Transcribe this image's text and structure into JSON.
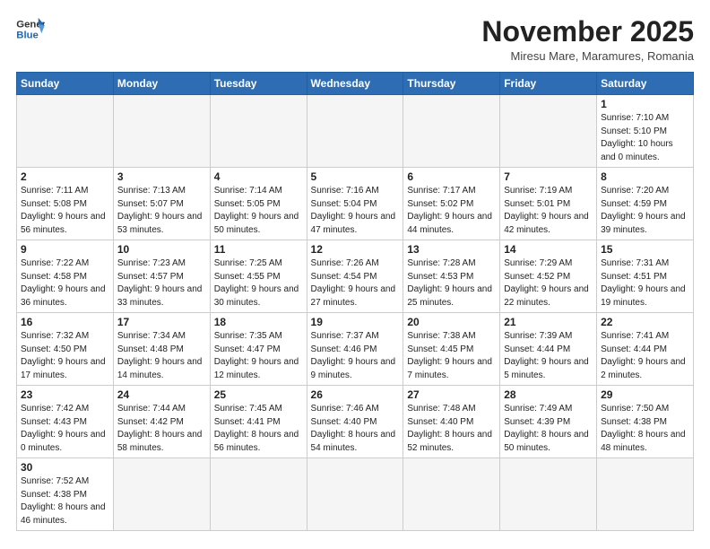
{
  "header": {
    "logo_general": "General",
    "logo_blue": "Blue",
    "month_title": "November 2025",
    "location": "Miresu Mare, Maramures, Romania"
  },
  "weekdays": [
    "Sunday",
    "Monday",
    "Tuesday",
    "Wednesday",
    "Thursday",
    "Friday",
    "Saturday"
  ],
  "weeks": [
    [
      {
        "day": "",
        "info": ""
      },
      {
        "day": "",
        "info": ""
      },
      {
        "day": "",
        "info": ""
      },
      {
        "day": "",
        "info": ""
      },
      {
        "day": "",
        "info": ""
      },
      {
        "day": "",
        "info": ""
      },
      {
        "day": "1",
        "info": "Sunrise: 7:10 AM\nSunset: 5:10 PM\nDaylight: 10 hours and 0 minutes."
      }
    ],
    [
      {
        "day": "2",
        "info": "Sunrise: 7:11 AM\nSunset: 5:08 PM\nDaylight: 9 hours and 56 minutes."
      },
      {
        "day": "3",
        "info": "Sunrise: 7:13 AM\nSunset: 5:07 PM\nDaylight: 9 hours and 53 minutes."
      },
      {
        "day": "4",
        "info": "Sunrise: 7:14 AM\nSunset: 5:05 PM\nDaylight: 9 hours and 50 minutes."
      },
      {
        "day": "5",
        "info": "Sunrise: 7:16 AM\nSunset: 5:04 PM\nDaylight: 9 hours and 47 minutes."
      },
      {
        "day": "6",
        "info": "Sunrise: 7:17 AM\nSunset: 5:02 PM\nDaylight: 9 hours and 44 minutes."
      },
      {
        "day": "7",
        "info": "Sunrise: 7:19 AM\nSunset: 5:01 PM\nDaylight: 9 hours and 42 minutes."
      },
      {
        "day": "8",
        "info": "Sunrise: 7:20 AM\nSunset: 4:59 PM\nDaylight: 9 hours and 39 minutes."
      }
    ],
    [
      {
        "day": "9",
        "info": "Sunrise: 7:22 AM\nSunset: 4:58 PM\nDaylight: 9 hours and 36 minutes."
      },
      {
        "day": "10",
        "info": "Sunrise: 7:23 AM\nSunset: 4:57 PM\nDaylight: 9 hours and 33 minutes."
      },
      {
        "day": "11",
        "info": "Sunrise: 7:25 AM\nSunset: 4:55 PM\nDaylight: 9 hours and 30 minutes."
      },
      {
        "day": "12",
        "info": "Sunrise: 7:26 AM\nSunset: 4:54 PM\nDaylight: 9 hours and 27 minutes."
      },
      {
        "day": "13",
        "info": "Sunrise: 7:28 AM\nSunset: 4:53 PM\nDaylight: 9 hours and 25 minutes."
      },
      {
        "day": "14",
        "info": "Sunrise: 7:29 AM\nSunset: 4:52 PM\nDaylight: 9 hours and 22 minutes."
      },
      {
        "day": "15",
        "info": "Sunrise: 7:31 AM\nSunset: 4:51 PM\nDaylight: 9 hours and 19 minutes."
      }
    ],
    [
      {
        "day": "16",
        "info": "Sunrise: 7:32 AM\nSunset: 4:50 PM\nDaylight: 9 hours and 17 minutes."
      },
      {
        "day": "17",
        "info": "Sunrise: 7:34 AM\nSunset: 4:48 PM\nDaylight: 9 hours and 14 minutes."
      },
      {
        "day": "18",
        "info": "Sunrise: 7:35 AM\nSunset: 4:47 PM\nDaylight: 9 hours and 12 minutes."
      },
      {
        "day": "19",
        "info": "Sunrise: 7:37 AM\nSunset: 4:46 PM\nDaylight: 9 hours and 9 minutes."
      },
      {
        "day": "20",
        "info": "Sunrise: 7:38 AM\nSunset: 4:45 PM\nDaylight: 9 hours and 7 minutes."
      },
      {
        "day": "21",
        "info": "Sunrise: 7:39 AM\nSunset: 4:44 PM\nDaylight: 9 hours and 5 minutes."
      },
      {
        "day": "22",
        "info": "Sunrise: 7:41 AM\nSunset: 4:44 PM\nDaylight: 9 hours and 2 minutes."
      }
    ],
    [
      {
        "day": "23",
        "info": "Sunrise: 7:42 AM\nSunset: 4:43 PM\nDaylight: 9 hours and 0 minutes."
      },
      {
        "day": "24",
        "info": "Sunrise: 7:44 AM\nSunset: 4:42 PM\nDaylight: 8 hours and 58 minutes."
      },
      {
        "day": "25",
        "info": "Sunrise: 7:45 AM\nSunset: 4:41 PM\nDaylight: 8 hours and 56 minutes."
      },
      {
        "day": "26",
        "info": "Sunrise: 7:46 AM\nSunset: 4:40 PM\nDaylight: 8 hours and 54 minutes."
      },
      {
        "day": "27",
        "info": "Sunrise: 7:48 AM\nSunset: 4:40 PM\nDaylight: 8 hours and 52 minutes."
      },
      {
        "day": "28",
        "info": "Sunrise: 7:49 AM\nSunset: 4:39 PM\nDaylight: 8 hours and 50 minutes."
      },
      {
        "day": "29",
        "info": "Sunrise: 7:50 AM\nSunset: 4:38 PM\nDaylight: 8 hours and 48 minutes."
      }
    ],
    [
      {
        "day": "30",
        "info": "Sunrise: 7:52 AM\nSunset: 4:38 PM\nDaylight: 8 hours and 46 minutes."
      },
      {
        "day": "",
        "info": ""
      },
      {
        "day": "",
        "info": ""
      },
      {
        "day": "",
        "info": ""
      },
      {
        "day": "",
        "info": ""
      },
      {
        "day": "",
        "info": ""
      },
      {
        "day": "",
        "info": ""
      }
    ]
  ]
}
